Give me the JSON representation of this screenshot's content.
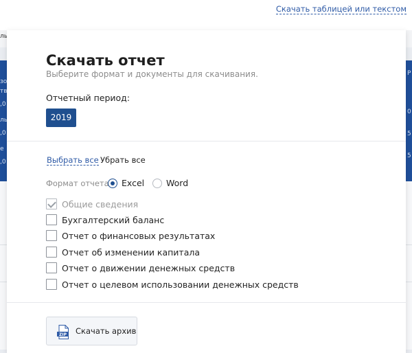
{
  "background": {
    "download_link": "Скачать таблицей или текстом",
    "left_fragments": [
      "ль",
      "зо",
      "тв",
      ",0",
      "ль",
      ",0",
      "е",
      ",0"
    ],
    "right_fragments": [
      "Р",
      "",
      "0",
      "",
      "5",
      "",
      "5",
      ""
    ]
  },
  "popup": {
    "title": "Скачать отчет",
    "subtitle": "Выберите формат и документы для скачивания.",
    "period_label": "Отчетный период:",
    "year": "2019",
    "select_all": "Выбрать все",
    "clear_all": "Убрать все",
    "format_label": "Формат отчета",
    "formats": [
      {
        "label": "Excel",
        "selected": true
      },
      {
        "label": "Word",
        "selected": false
      }
    ],
    "documents": [
      {
        "label": "Общие сведения",
        "checked": true,
        "disabled": true
      },
      {
        "label": "Бухгалтерский баланс",
        "checked": false,
        "disabled": false
      },
      {
        "label": "Отчет о финансовых результатах",
        "checked": false,
        "disabled": false
      },
      {
        "label": "Отчет об изменении капитала",
        "checked": false,
        "disabled": false
      },
      {
        "label": "Отчет о движении денежных средств",
        "checked": false,
        "disabled": false
      },
      {
        "label": "Отчет о целевом использовании денежных средств",
        "checked": false,
        "disabled": false
      }
    ],
    "download_button": "Скачать архив",
    "zip_icon_text": "ZIP"
  }
}
